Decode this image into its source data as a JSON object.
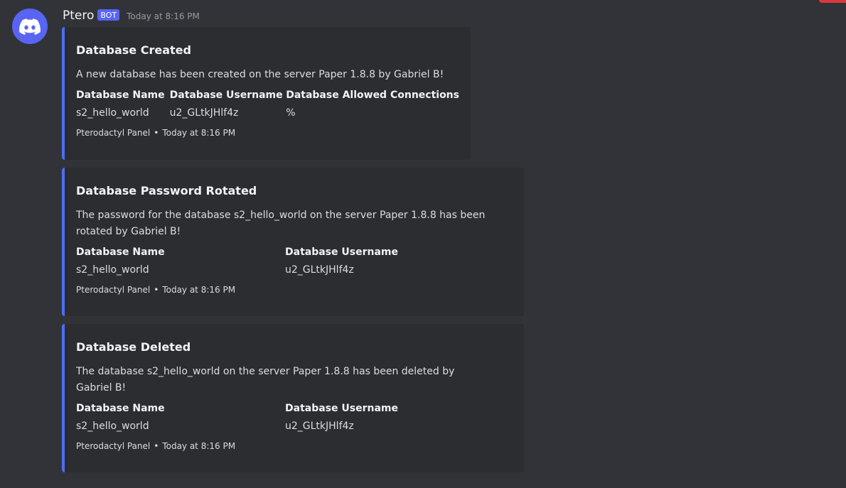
{
  "message": {
    "author": "Ptero",
    "bot_tag": "BOT",
    "timestamp": "Today at 8:16 PM"
  },
  "colors": {
    "background": "#313338",
    "embed_background": "#2b2d31",
    "embed_accent": "#4c6ef5",
    "brand": "#5865f2"
  },
  "icons": {
    "avatar": "discord-logo-icon"
  },
  "embeds": [
    {
      "title": "Database Created",
      "description": "A new database has been created on the server Paper 1.8.8 by Gabriel B!",
      "fields": [
        {
          "name": "Database Name",
          "value": "s2_hello_world"
        },
        {
          "name": "Database Username",
          "value": "u2_GLtkJHlf4z"
        },
        {
          "name": "Database Allowed Connections",
          "value": "%"
        }
      ],
      "footer": {
        "source": "Pterodactyl Panel",
        "separator": "•",
        "time": "Today at 8:16 PM"
      }
    },
    {
      "title": "Database Password Rotated",
      "description": "The password for the database s2_hello_world on the server Paper 1.8.8 has been rotated by Gabriel B!",
      "fields": [
        {
          "name": "Database Name",
          "value": "s2_hello_world"
        },
        {
          "name": "Database Username",
          "value": "u2_GLtkJHlf4z"
        }
      ],
      "footer": {
        "source": "Pterodactyl Panel",
        "separator": "•",
        "time": "Today at 8:16 PM"
      }
    },
    {
      "title": "Database Deleted",
      "description": "The database s2_hello_world on the server Paper 1.8.8 has been deleted by Gabriel B!",
      "fields": [
        {
          "name": "Database Name",
          "value": "s2_hello_world"
        },
        {
          "name": "Database Username",
          "value": "u2_GLtkJHlf4z"
        }
      ],
      "footer": {
        "source": "Pterodactyl Panel",
        "separator": "•",
        "time": "Today at 8:16 PM"
      }
    }
  ]
}
